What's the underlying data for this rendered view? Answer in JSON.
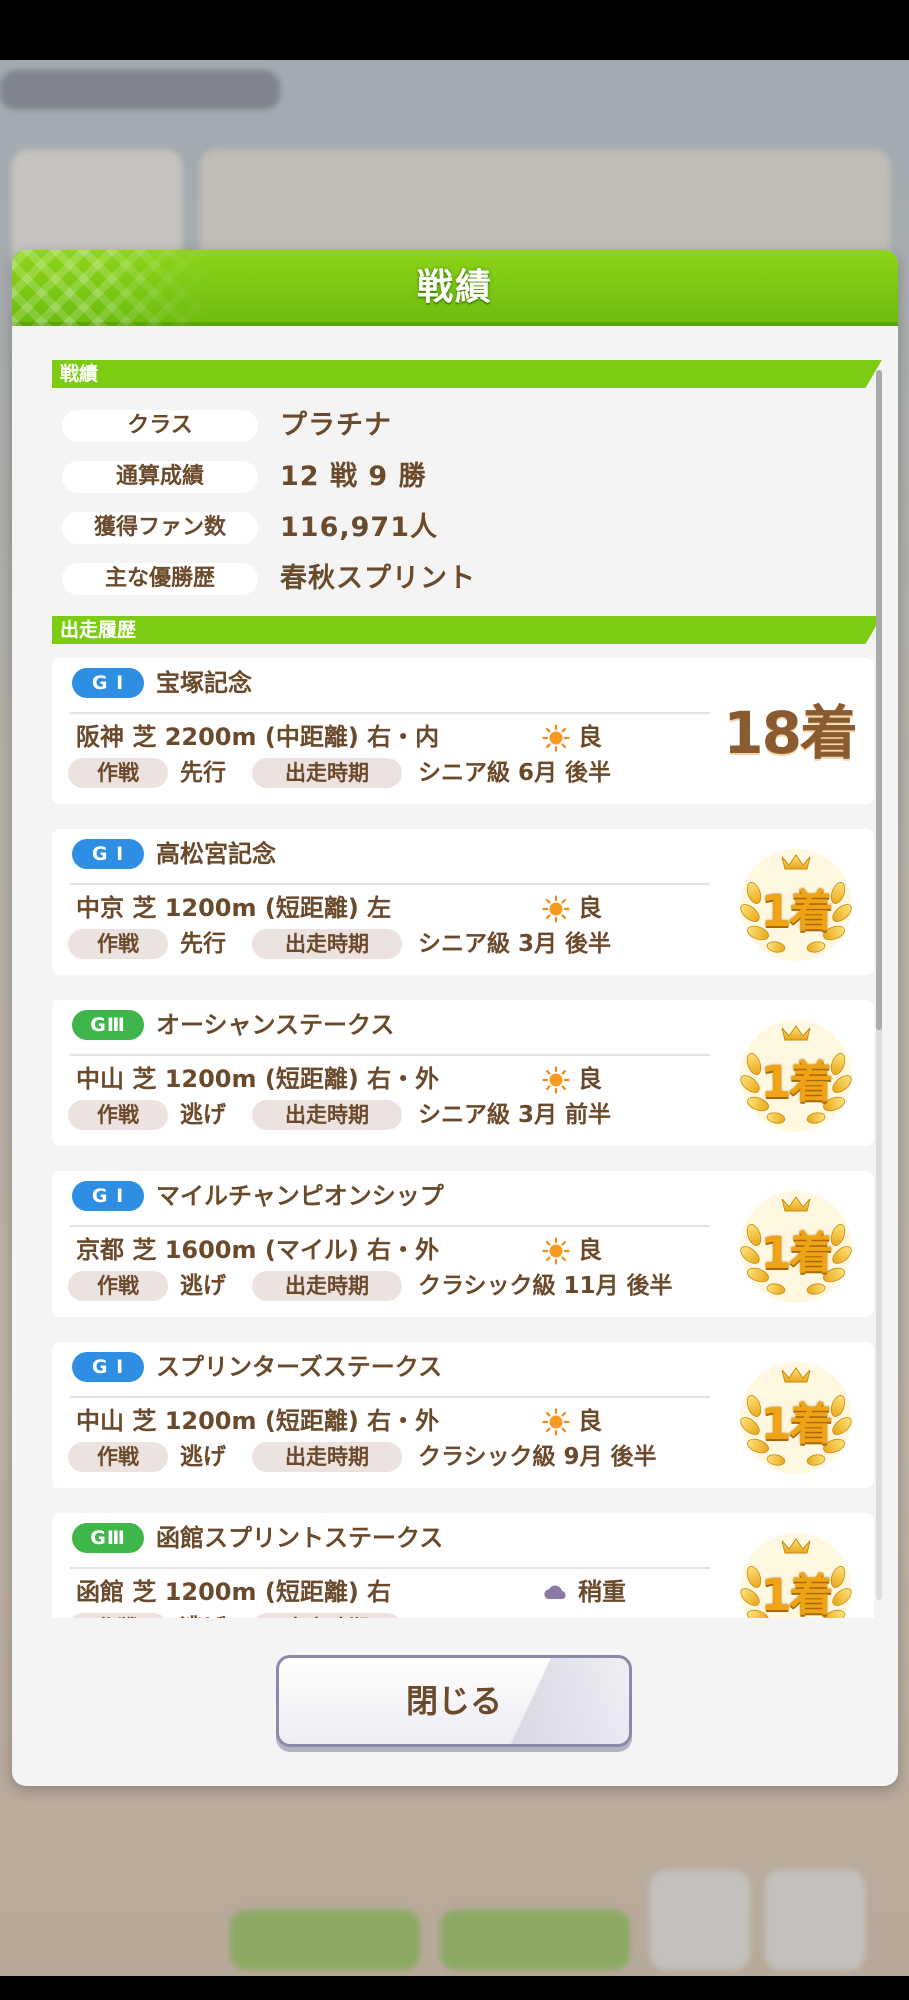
{
  "modal": {
    "title": "戦績"
  },
  "summary": {
    "section_label": "戦績",
    "rows": [
      {
        "label": "クラス",
        "value": "プラチナ"
      },
      {
        "label": "通算成績",
        "value": "12 戦 9 勝"
      },
      {
        "label": "獲得ファン数",
        "value": "116,971人"
      },
      {
        "label": "主な優勝歴",
        "value": "春秋スプリント"
      }
    ]
  },
  "history": {
    "section_label": "出走履歴",
    "tactic_label": "作戦",
    "period_label": "出走時期",
    "races": [
      {
        "grade": "G I",
        "grade_class": "g1",
        "name": "宝塚記念",
        "course": "阪神 芝 2200m (中距離) 右・内",
        "weather": "sunny",
        "going": "良",
        "tactic": "先行",
        "period": "シニア級 6月 後半",
        "place": "18着"
      },
      {
        "grade": "G I",
        "grade_class": "g1",
        "name": "高松宮記念",
        "course": "中京 芝 1200m (短距離) 左",
        "weather": "sunny",
        "going": "良",
        "tactic": "先行",
        "period": "シニア級 3月 後半",
        "place": "1着"
      },
      {
        "grade": "GⅢ",
        "grade_class": "g3",
        "name": "オーシャンステークス",
        "course": "中山 芝 1200m (短距離) 右・外",
        "weather": "sunny",
        "going": "良",
        "tactic": "逃げ",
        "period": "シニア級 3月 前半",
        "place": "1着"
      },
      {
        "grade": "G I",
        "grade_class": "g1",
        "name": "マイルチャンピオンシップ",
        "course": "京都 芝 1600m (マイル) 右・外",
        "weather": "sunny",
        "going": "良",
        "tactic": "逃げ",
        "period": "クラシック級 11月 後半",
        "place": "1着"
      },
      {
        "grade": "G I",
        "grade_class": "g1",
        "name": "スプリンターズステークス",
        "course": "中山 芝 1200m (短距離) 右・外",
        "weather": "sunny",
        "going": "良",
        "tactic": "逃げ",
        "period": "クラシック級 9月 後半",
        "place": "1着"
      },
      {
        "grade": "GⅢ",
        "grade_class": "g3",
        "name": "函館スプリントステークス",
        "course": "函館 芝 1200m (短距離) 右",
        "weather": "cloudy",
        "going": "稍重",
        "tactic": "逃げ",
        "period": "",
        "place": "1着"
      }
    ]
  },
  "close_button": {
    "label": "閉じる"
  },
  "colors": {
    "header_green": "#7ccc14",
    "text_brown": "#6b4a2b",
    "g1_blue": "#2d8ee3",
    "g3_green": "#3fb64a",
    "gold": "#e8a81c"
  }
}
